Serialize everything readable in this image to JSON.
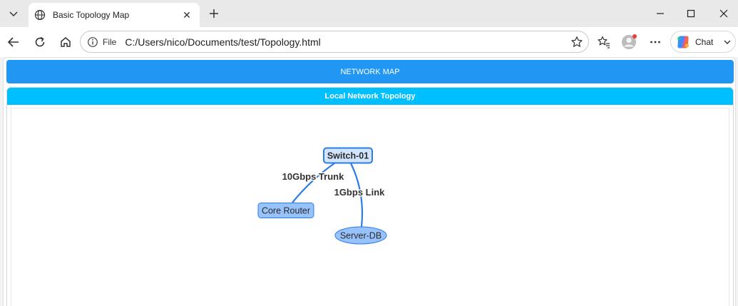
{
  "browser": {
    "tab": {
      "title": "Basic Topology Map",
      "close_glyph": "✕"
    },
    "new_tab_glyph": "+",
    "address": {
      "scheme_label": "File",
      "url": "C:/Users/nico/Documents/test/Topology.html"
    },
    "chat": {
      "label": "Chat"
    },
    "icons": [
      "tab-list-icon",
      "globe-icon",
      "close-icon",
      "plus-icon",
      "minimize-icon",
      "maximize-icon",
      "close-window-icon",
      "back-icon",
      "reload-icon",
      "home-icon",
      "info-icon",
      "star-icon",
      "favorites-icon",
      "profile-icon",
      "more-icon",
      "copilot-icon",
      "chevron-down-icon"
    ],
    "colors": {
      "profile_dot": "#e8403a",
      "accent": "#2196f3"
    }
  },
  "page": {
    "header_title": "NETWORK MAP",
    "panel_title": "Local Network Topology",
    "colors": {
      "header_bg": "#2196f3",
      "panel_header_bg": "#00bfff",
      "node_fill": "#97c2fc",
      "node_border": "#2b7ce9",
      "edge": "#2b7ce9"
    }
  },
  "topology": {
    "nodes": [
      {
        "id": "switch",
        "label": "Switch-01",
        "shape": "box",
        "selected": true
      },
      {
        "id": "router",
        "label": "Core Router",
        "shape": "box",
        "selected": false
      },
      {
        "id": "server",
        "label": "Server-DB",
        "shape": "ellipse",
        "selected": false
      }
    ],
    "edges": [
      {
        "from": "switch",
        "to": "router",
        "label": "10Gbps Trunk"
      },
      {
        "from": "switch",
        "to": "server",
        "label": "1Gbps Link"
      }
    ]
  }
}
